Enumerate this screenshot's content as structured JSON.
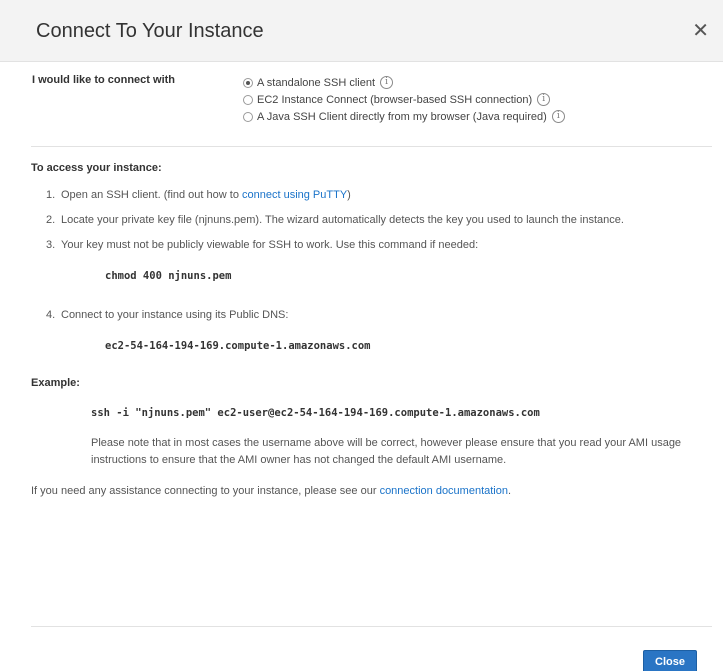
{
  "dialog": {
    "title": "Connect To Your Instance",
    "close_icon": "close-icon"
  },
  "connect": {
    "label": "I would like to connect with",
    "options": [
      {
        "label": "A standalone SSH client",
        "selected": true
      },
      {
        "label": "EC2 Instance Connect (browser-based SSH connection)",
        "selected": false
      },
      {
        "label": "A Java SSH Client directly from my browser (Java required)",
        "selected": false
      }
    ],
    "info_glyph": "i"
  },
  "access": {
    "title": "To access your instance:",
    "steps": {
      "s1_num": "1.",
      "s1_text": "Open an SSH client. (find out how to ",
      "s1_link": "connect using PuTTY",
      "s1_end": ")",
      "s2_num": "2.",
      "s2_text": "Locate your private key file (njnuns.pem). The wizard automatically detects the key you used to launch the instance.",
      "s3_num": "3.",
      "s3_text": "Your key must not be publicly viewable for SSH to work. Use this command if needed:",
      "s3_cmd": "chmod 400 njnuns.pem",
      "s4_num": "4.",
      "s4_text": "Connect to your instance using its Public DNS:",
      "s4_dns": "ec2-54-164-194-169.compute-1.amazonaws.com"
    }
  },
  "example": {
    "title": "Example:",
    "command": "ssh -i \"njnuns.pem\" ec2-user@ec2-54-164-194-169.compute-1.amazonaws.com",
    "note": "Please note that in most cases the username above will be correct, however please ensure that you read your AMI usage instructions to ensure that the AMI owner has not changed the default AMI username."
  },
  "assist": {
    "text": "If you need any assistance connecting to your instance, please see our ",
    "link": "connection documentation",
    "end": "."
  },
  "footer": {
    "close_label": "Close"
  },
  "colors": {
    "link": "#1a73c9",
    "primary_button": "#2a75c4",
    "header_bg": "#f3f3f3"
  }
}
